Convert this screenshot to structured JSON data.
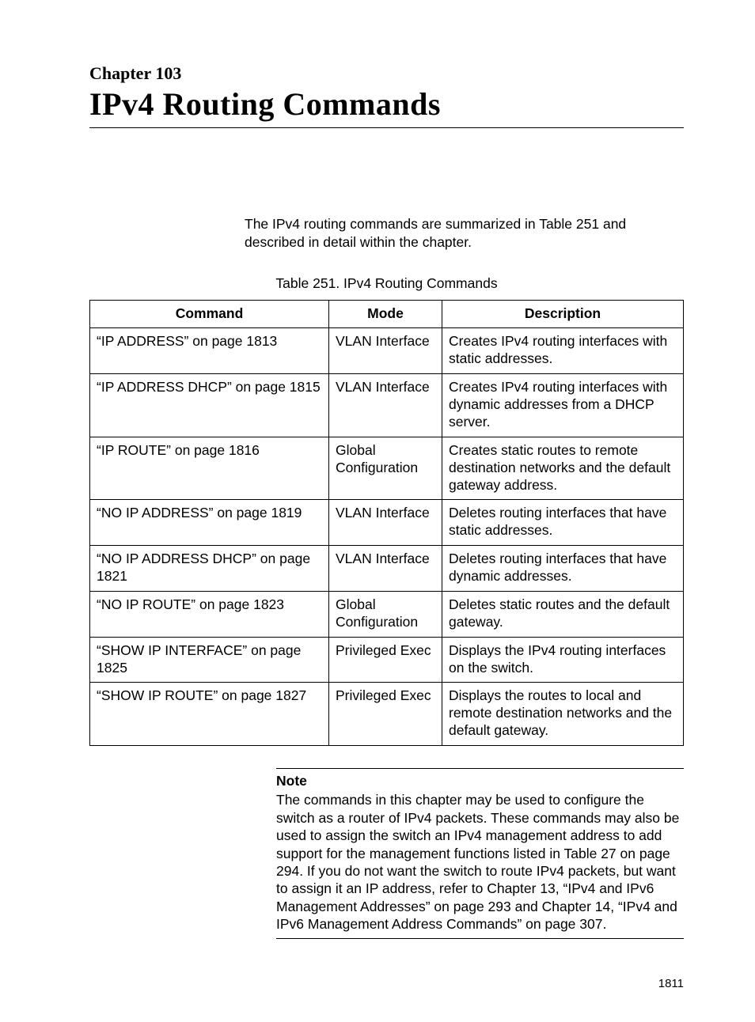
{
  "chapter": {
    "label": "Chapter 103",
    "title": "IPv4 Routing Commands"
  },
  "intro": "The IPv4 routing commands are summarized in Table 251 and described in detail within the chapter.",
  "table": {
    "caption": "Table 251. IPv4 Routing Commands",
    "headers": [
      "Command",
      "Mode",
      "Description"
    ],
    "rows": [
      {
        "command": "“IP ADDRESS” on page 1813",
        "mode": "VLAN Interface",
        "desc": "Creates IPv4 routing interfaces with static addresses."
      },
      {
        "command": "“IP ADDRESS DHCP” on page 1815",
        "mode": "VLAN Interface",
        "desc": "Creates IPv4 routing interfaces with dynamic addresses from a DHCP server."
      },
      {
        "command": "“IP ROUTE” on page 1816",
        "mode": "Global Configuration",
        "desc": "Creates static routes to remote destination networks and the default gateway address."
      },
      {
        "command": "“NO IP ADDRESS” on page 1819",
        "mode": "VLAN Interface",
        "desc": "Deletes routing interfaces that have static addresses."
      },
      {
        "command": "“NO IP ADDRESS DHCP” on page 1821",
        "mode": "VLAN Interface",
        "desc": "Deletes routing interfaces that have dynamic addresses."
      },
      {
        "command": "“NO IP ROUTE” on page 1823",
        "mode": "Global Configuration",
        "desc": "Deletes static routes and the default gateway."
      },
      {
        "command": "“SHOW IP INTERFACE” on page 1825",
        "mode": "Privileged Exec",
        "desc": "Displays the IPv4 routing interfaces on the switch."
      },
      {
        "command": "“SHOW IP ROUTE” on page 1827",
        "mode": "Privileged Exec",
        "desc": "Displays the routes to local and remote destination networks and the default gateway."
      }
    ]
  },
  "note": {
    "label": "Note",
    "body": "The commands in this chapter may be used to configure the switch as a router of IPv4 packets. These commands may also be used to assign the switch an IPv4 management address to add support for the management functions listed in Table 27 on page 294. If you do not want the switch to route IPv4 packets, but want to assign it an IP address, refer to Chapter 13, “IPv4 and IPv6 Management Addresses” on page 293 and Chapter 14, “IPv4 and IPv6 Management Address Commands” on page 307."
  },
  "page_number": "1811"
}
